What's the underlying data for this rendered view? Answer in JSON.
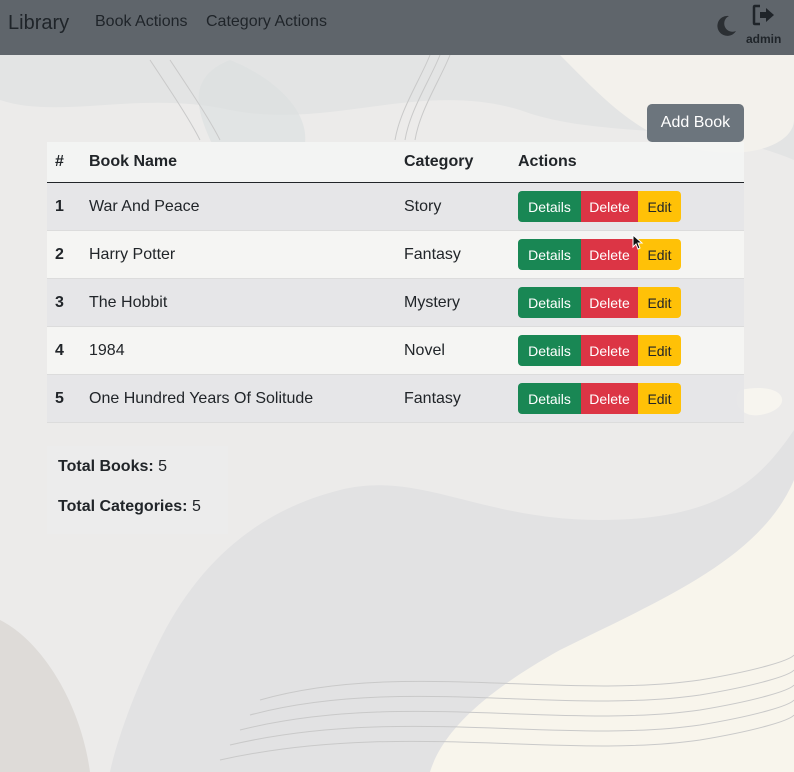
{
  "navbar": {
    "brand": "Library",
    "links": [
      "Book Actions",
      "Category Actions"
    ],
    "theme_icon": "moon-icon",
    "logout_icon": "logout-icon",
    "username": "admin"
  },
  "actions": {
    "add_book": "Add Book"
  },
  "table": {
    "headers": [
      "#",
      "Book Name",
      "Category",
      "Actions"
    ],
    "rows": [
      {
        "num": "1",
        "name": "War And Peace",
        "category": "Story"
      },
      {
        "num": "2",
        "name": "Harry Potter",
        "category": "Fantasy"
      },
      {
        "num": "3",
        "name": "The Hobbit",
        "category": "Mystery"
      },
      {
        "num": "4",
        "name": "1984",
        "category": "Novel"
      },
      {
        "num": "5",
        "name": "One Hundred Years Of Solitude",
        "category": "Fantasy"
      }
    ],
    "row_buttons": {
      "details": "Details",
      "delete": "Delete",
      "edit": "Edit"
    }
  },
  "totals": {
    "books_label": "Total Books:",
    "books_value": "5",
    "categories_label": "Total Categories:",
    "categories_value": "5"
  },
  "colors": {
    "navbar": "#5f656b",
    "details": "#198754",
    "delete": "#dc3545",
    "edit": "#ffc107",
    "secondary": "#6c757d"
  }
}
